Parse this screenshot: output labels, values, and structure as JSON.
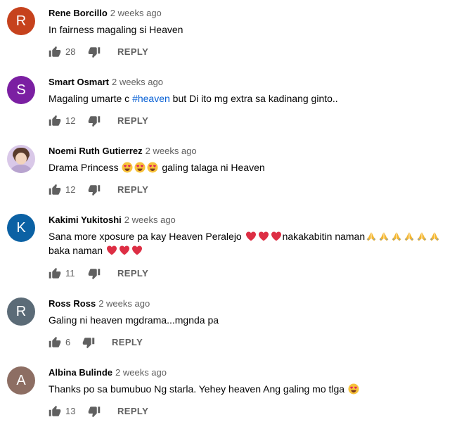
{
  "comments": [
    {
      "author": "Rene Borcillo",
      "time": "2 weeks ago",
      "avatar_letter": "R",
      "avatar_color": "#c6421d",
      "lines": [
        "In fairness magaling si Heaven"
      ],
      "likes": "28",
      "reply_label": "REPLY"
    },
    {
      "author": "Smart Osmart",
      "time": "2 weeks ago",
      "avatar_letter": "S",
      "avatar_color": "#7b1fa2",
      "text_before": "Magaling umarte c ",
      "hashtag": "#heaven",
      "text_after": " but Di ito mg extra sa kadinang ginto..",
      "likes": "12",
      "reply_label": "REPLY"
    },
    {
      "author": "Noemi Ruth Gutierrez",
      "time": "2 weeks ago",
      "avatar_type": "photo",
      "text_before": "Drama Princess ",
      "emojis": [
        "heart-eyes-emoji",
        "heart-eyes-emoji",
        "heart-eyes-emoji"
      ],
      "text_after": " galing talaga ni Heaven",
      "likes": "12",
      "reply_label": "REPLY"
    },
    {
      "author": "Kakimi Yukitoshi",
      "time": "2 weeks ago",
      "avatar_letter": "K",
      "avatar_color": "#0b61a4",
      "line1_before": "Sana more xposure pa kay Heaven Peralejo ",
      "line1_emojis": [
        "red-heart-emoji",
        "red-heart-emoji",
        "red-heart-emoji"
      ],
      "line1_after": "nakakabitin naman",
      "line1_tail_emojis": [
        "folded-hands-emoji",
        "folded-hands-emoji",
        "folded-hands-emoji",
        "folded-hands-emoji",
        "folded-hands-emoji",
        "folded-hands-emoji"
      ],
      "line2_before": "baka naman ",
      "line2_emojis": [
        "red-heart-emoji",
        "red-heart-emoji",
        "red-heart-emoji"
      ],
      "likes": "11",
      "reply_label": "REPLY"
    },
    {
      "author": "Ross Ross",
      "time": "2 weeks ago",
      "avatar_letter": "R",
      "avatar_color": "#5b6b77",
      "lines": [
        "Galing ni heaven mgdrama...mgnda pa"
      ],
      "likes": "6",
      "reply_label": "REPLY"
    },
    {
      "author": "Albina Bulinde",
      "time": "2 weeks ago",
      "avatar_letter": "A",
      "avatar_color": "#8d6e63",
      "text_before": "Thanks po sa bumubuo Ng starla. Yehey heaven Ang galing mo tlga ",
      "emojis": [
        "heart-eyes-emoji"
      ],
      "likes": "13",
      "reply_label": "REPLY"
    }
  ]
}
